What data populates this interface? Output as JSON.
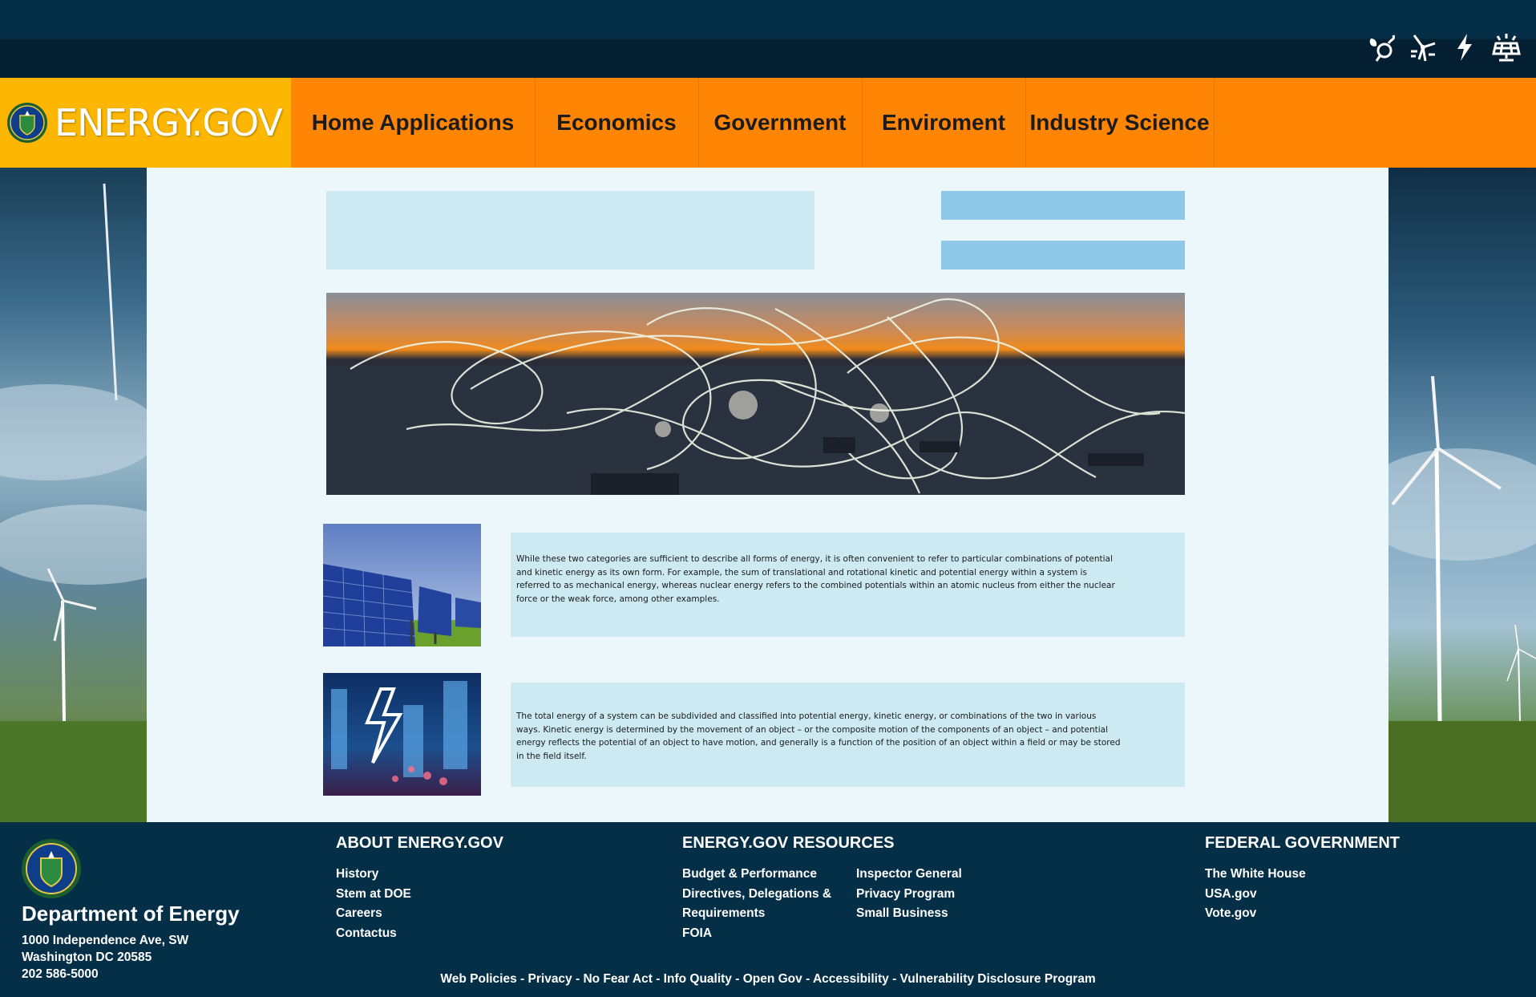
{
  "header": {
    "brand": "ENERGY.GOV",
    "icons": [
      "leaf-bulb-icon",
      "wind-turbine-icon",
      "lightning-icon",
      "solar-panel-icon"
    ]
  },
  "nav": {
    "items": [
      "Home Applications",
      "Economics",
      "Government",
      "Enviroment",
      "Industry Science"
    ]
  },
  "main": {
    "paragraphs": [
      "While these two categories are sufficient to describe all forms of energy, it is often convenient to refer to particular combinations of potential and kinetic energy as its own form. For example, the sum of translational and rotational kinetic and potential energy within a system is referred to as mechanical energy, whereas nuclear energy refers to the combined potentials within an atomic nucleus from either the nuclear force or the weak force, among other examples.",
      "The total energy of a system can be subdivided and classified into potential energy, kinetic energy, or combinations of the two in various ways. Kinetic energy is determined by the movement of an object – or the composite motion of the components of an object – and potential energy reflects the potential of an object to have motion, and generally is a function of the position of an object within a field or may be stored in the field itself."
    ]
  },
  "footer": {
    "department": "Department of Energy",
    "address": [
      "1000 Independence Ave, SW",
      "Washington DC 20585",
      "202 586-5000"
    ],
    "about": {
      "title": "ABOUT ENERGY.GOV",
      "links": [
        "History",
        "Stem at DOE",
        "Careers",
        "Contactus"
      ]
    },
    "resources": {
      "title": "ENERGY.GOV RESOURCES",
      "col1": [
        "Budget & Performance",
        "Directives, Delegations &",
        "Requirements",
        "FOIA"
      ],
      "col2": [
        "Inspector General",
        "Privacy Program",
        "Small Business"
      ]
    },
    "federal": {
      "title": "FEDERAL GOVERNMENT",
      "links": [
        "The White House",
        "USA.gov",
        "Vote.gov"
      ]
    },
    "bottom_links": [
      "Web Policies",
      "Privacy",
      "No Fear Act",
      "Info Quality",
      "Open Gov",
      "Accessibility",
      "Vulnerability Disclosure Program"
    ]
  },
  "colors": {
    "nav_orange": "#fe8604",
    "brand_yellow": "#fdb702",
    "dark_navy": "#052f47",
    "content_bg": "#ecf7fb",
    "placeholder_light": "#cde9f2",
    "placeholder_blue": "#8ec9e7"
  }
}
